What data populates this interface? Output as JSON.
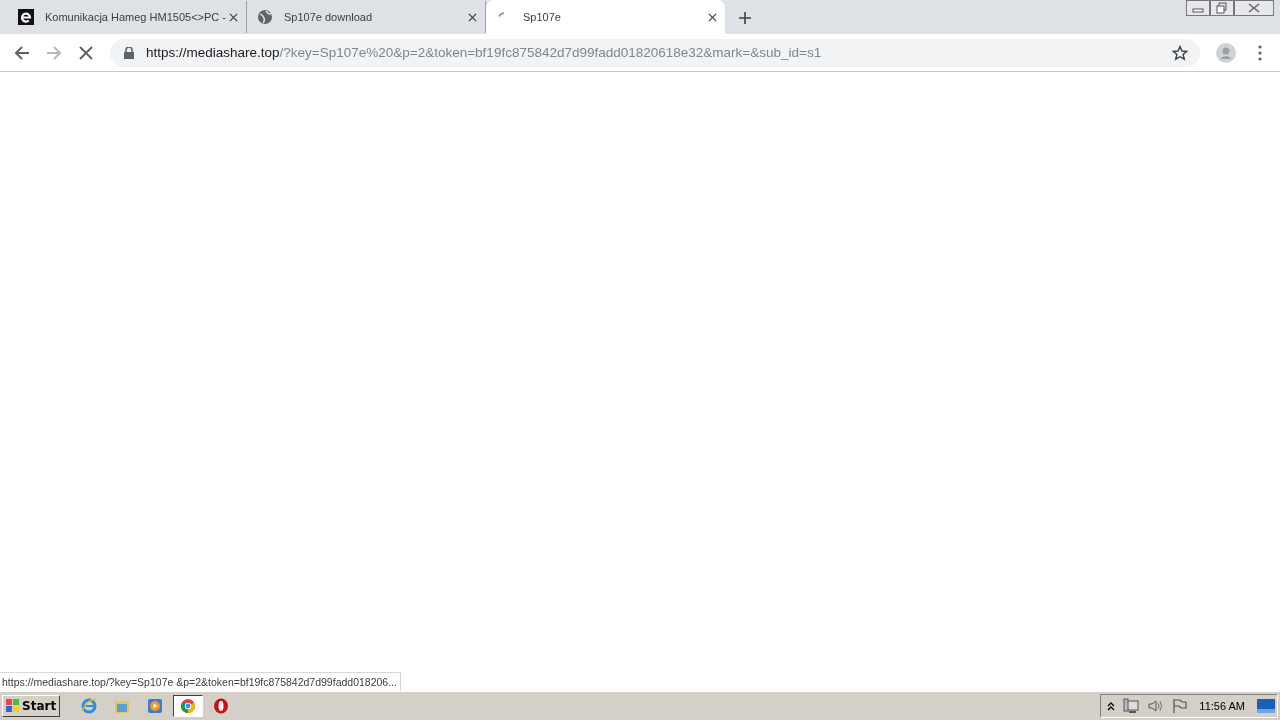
{
  "tabs": [
    {
      "title": "Komunikacja Hameg HM1505<>PC -",
      "kind": "e-logo",
      "selected": false
    },
    {
      "title": "Sp107e download",
      "kind": "globe",
      "selected": false
    },
    {
      "title": "Sp107e",
      "kind": "spinner",
      "selected": true
    }
  ],
  "address_bar": {
    "host": "https://mediashare.top",
    "path": "/?key=Sp107e%20&p=2&token=bf19fc875842d7d99fadd01820618e32&mark=&sub_id=s1"
  },
  "status_bubble": "https://mediashare.top/?key=Sp107e &p=2&token=bf19fc875842d7d99fadd018206...",
  "taskbar": {
    "start": "Start",
    "apps": [
      {
        "kind": "ie",
        "active": false
      },
      {
        "kind": "folder",
        "active": false
      },
      {
        "kind": "media",
        "active": false
      },
      {
        "kind": "chrome",
        "active": true
      },
      {
        "kind": "opera",
        "active": false
      }
    ],
    "clock": "11:56 AM"
  }
}
